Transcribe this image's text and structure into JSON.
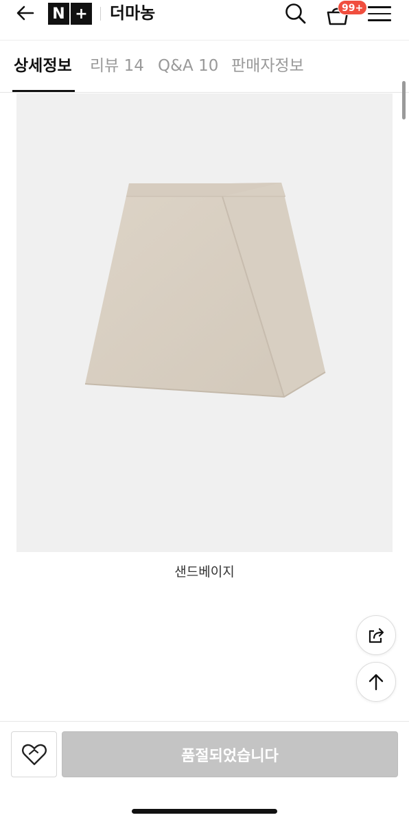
{
  "header": {
    "back_icon": "arrow-left-icon",
    "logo": [
      "N",
      "+"
    ],
    "store_name": "더마농",
    "search_icon": "search-icon",
    "cart_icon": "shopping-basket-icon",
    "cart_badge": "99+",
    "menu_icon": "hamburger-menu-icon"
  },
  "tabs": [
    {
      "label": "상세정보",
      "active": true
    },
    {
      "label": "리뷰 14",
      "active": false
    },
    {
      "label": "Q&A 10",
      "active": false
    },
    {
      "label": "판매자정보",
      "active": false
    }
  ],
  "product": {
    "image_subject": "beige wrap mini skirt",
    "caption": "샌드베이지"
  },
  "floating": {
    "share_icon": "share-icon",
    "top_icon": "arrow-up-icon"
  },
  "bottom_bar": {
    "wish_icon": "heart-icon",
    "soldout_label": "품절되었습니다"
  },
  "colors": {
    "badge": "#f04e3e",
    "soldout_bg": "#c4c4c4",
    "skirt": "#dbd2c5",
    "image_bg": "#f0f0f0"
  }
}
